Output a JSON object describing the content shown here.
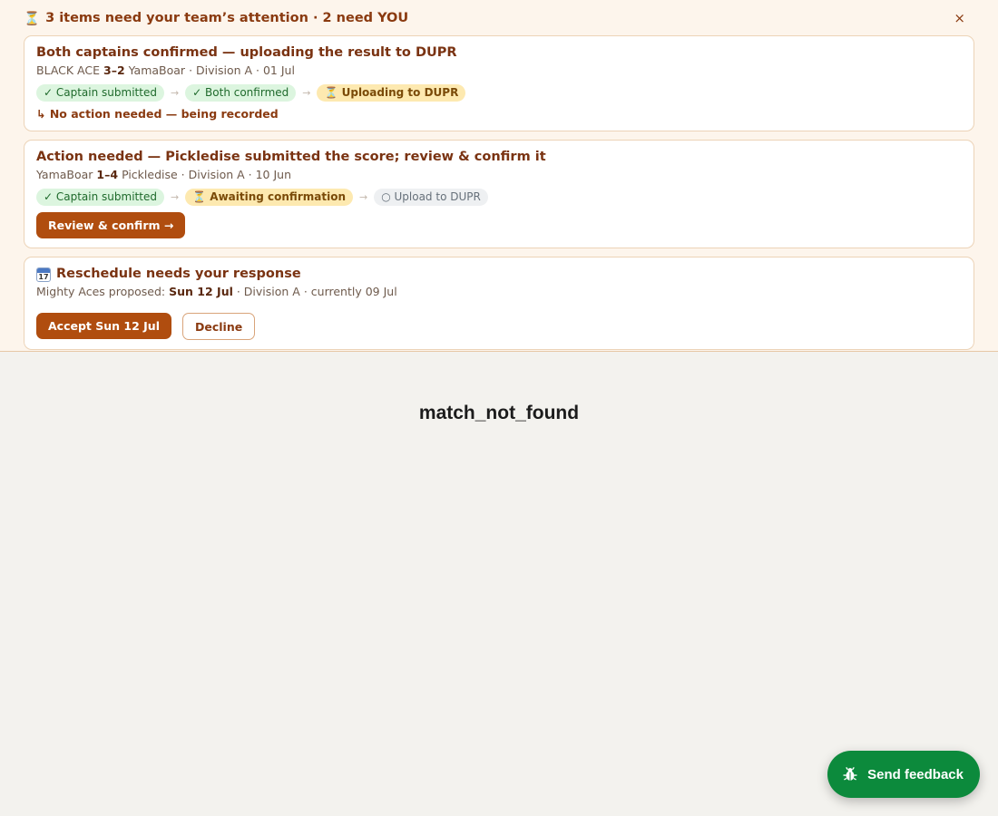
{
  "banner": {
    "icon": "hourglass-icon",
    "title": "3 items need your team’s attention · 2 need YOU",
    "close": "×"
  },
  "cards": [
    {
      "title": "Both captains confirmed — uploading the result to DUPR",
      "team_a": "BLACK ACE",
      "score": "3–2",
      "team_b": "YamaBoar",
      "meta": "· Division A · 01 Jul",
      "steps": [
        "✓ Captain submitted",
        "✓ Both confirmed",
        "⏳ Uploading to DUPR"
      ],
      "note": "↳ No action needed — being recorded"
    },
    {
      "title": "Action needed — Pickledise submitted the score; review & confirm it",
      "team_a": "YamaBoar",
      "score": "1–4",
      "team_b": "Pickledise",
      "meta": "· Division A · 10 Jun",
      "steps": [
        "✓ Captain submitted",
        "⏳ Awaiting confirmation",
        "○ Upload to DUPR"
      ],
      "button": "Review & confirm →"
    },
    {
      "title": "Reschedule needs your response",
      "calendar_day": "17",
      "proposed_prefix": "Mighty Aces proposed:",
      "proposed_date": "Sun 12 Jul",
      "meta": "· Division A · currently 09 Jul",
      "accept": "Accept Sun 12 Jul",
      "decline": "Decline"
    }
  ],
  "main": {
    "message": "match_not_found"
  },
  "feedback": {
    "label": "Send feedback",
    "icon": "bug-icon"
  },
  "arrow": "→"
}
